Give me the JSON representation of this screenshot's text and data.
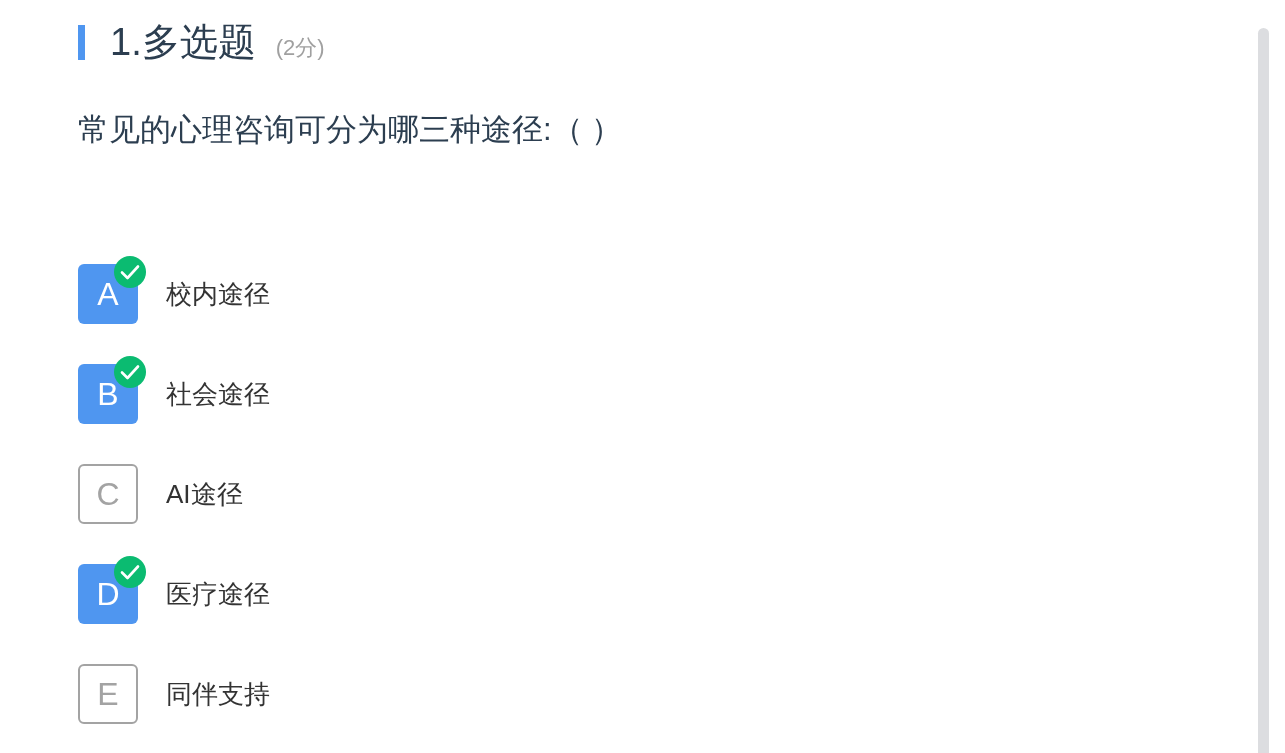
{
  "question": {
    "title": "1.多选题",
    "score": "(2分)",
    "text": "常见的心理咨询可分为哪三种途径:（ ）"
  },
  "options": [
    {
      "letter": "A",
      "text": "校内途径",
      "selected": true
    },
    {
      "letter": "B",
      "text": "社会途径",
      "selected": true
    },
    {
      "letter": "C",
      "text": "AI途径",
      "selected": false
    },
    {
      "letter": "D",
      "text": "医疗途径",
      "selected": true
    },
    {
      "letter": "E",
      "text": "同伴支持",
      "selected": false
    }
  ]
}
